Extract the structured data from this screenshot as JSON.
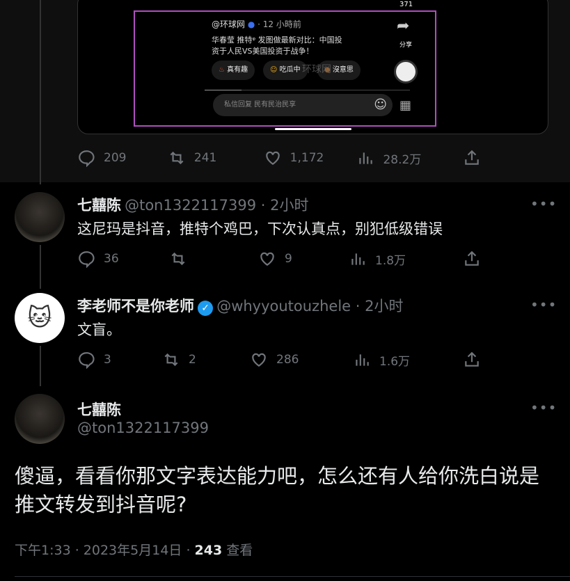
{
  "embed": {
    "count": "371",
    "account": "@环球网",
    "time": "· 12 小時前",
    "text_line1": "华春莹 推特ᵠ 发图做最新对比：中国投",
    "text_line2": "资于人民VS美国投资于战争！",
    "share": "分享",
    "chips": [
      "真有趣",
      "吃瓜中",
      "沒意思"
    ],
    "watermark": "环球网",
    "input_placeholder": "私信回复 民有民治民享"
  },
  "main_actions": {
    "replies": "209",
    "retweets": "241",
    "likes": "1,172",
    "views": "28.2万"
  },
  "replies": [
    {
      "name": "七囍陈",
      "handle": "@ton1322117399 · 2小时",
      "text": "这尼玛是抖音，推特个鸡巴，下次认真点，别犯低级错误",
      "replies": "36",
      "retweets": "",
      "likes": "9",
      "views": "1.8万"
    },
    {
      "name": "李老师不是你老师",
      "handle": "@whyyoutouzhele · 2小时",
      "text": "文盲。",
      "replies": "3",
      "retweets": "2",
      "likes": "286",
      "views": "1.6万"
    }
  ],
  "focus": {
    "name": "七囍陈",
    "handle": "@ton1322117399",
    "text": "傻逼，看看你那文字表达能力吧，怎么还有人给你洗白说是推文转发到抖音呢?",
    "timestamp": "下午1:33 · 2023年5月14日 · ",
    "views": "243",
    "views_label": " 查看"
  },
  "more": "•••"
}
